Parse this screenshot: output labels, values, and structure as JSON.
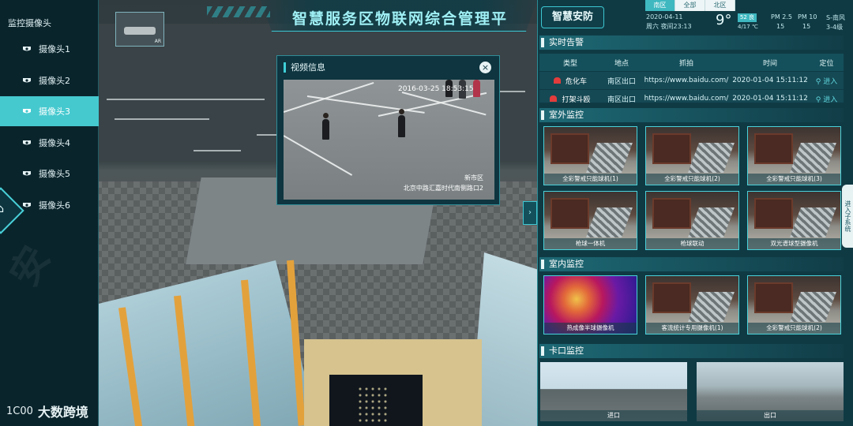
{
  "header": {
    "title": "智慧服务区物联网综合管理平"
  },
  "minimap": {
    "label": "AR"
  },
  "sidebar": {
    "heading": "监控摄像头",
    "items": [
      {
        "label": "摄像头1",
        "active": false
      },
      {
        "label": "摄像头2",
        "active": false
      },
      {
        "label": "摄像头3",
        "active": true
      },
      {
        "label": "摄像头4",
        "active": false
      },
      {
        "label": "摄像头5",
        "active": false
      },
      {
        "label": "摄像头6",
        "active": false
      }
    ],
    "home_icon": "home-icon"
  },
  "video": {
    "title": "视频信息",
    "close_label": "×",
    "timestamp": "2016-03-25  18:53:15",
    "location_line1": "新市区",
    "location_line2": "北京中路汇嘉时代南侧路口2"
  },
  "right": {
    "module_title": "智慧安防",
    "tabs": [
      {
        "label": "南区",
        "active": true
      },
      {
        "label": "全部",
        "active": false
      },
      {
        "label": "北区",
        "active": false
      }
    ],
    "weather": {
      "date": "2020-04-11",
      "week": "周六 夜间23:13",
      "temp": "9°",
      "badge": "52 良",
      "range": "4/17 ℃",
      "metrics": [
        {
          "label": "PM 2.5",
          "value": "15"
        },
        {
          "label": "PM 10",
          "value": "15"
        },
        {
          "label": "S-南风",
          "value": "3-4级"
        }
      ]
    },
    "alarm": {
      "title": "实时告警",
      "headers": [
        "类型",
        "地点",
        "抓拍",
        "时间",
        "定位"
      ],
      "rows": [
        {
          "type": "危化车",
          "place": "南区出口",
          "snapshot": "https://www.baidu.com/",
          "time": "2020-01-04 15:11:12",
          "action": "进入"
        },
        {
          "type": "打架斗殴",
          "place": "南区出口",
          "snapshot": "https://www.baidu.com/",
          "time": "2020-01-04 15:11:12",
          "action": "进入"
        }
      ]
    },
    "outdoor": {
      "title": "室外监控",
      "cams": [
        "全彩警戒只能球机(1)",
        "全彩警戒只能球机(2)",
        "全彩警戒只能球机(3)",
        "枪球一体机",
        "枪球联动",
        "双光谱球型摄像机"
      ]
    },
    "indoor": {
      "title": "室内监控",
      "cams": [
        "热成像半球摄像机",
        "客流统计专用摄像机(1)",
        "全彩警戒只能球机(2)"
      ]
    },
    "gate": {
      "title": "卡口监控",
      "cams": [
        "进口",
        "出口"
      ]
    },
    "subsystem": "进入子系统",
    "collapse": "›"
  },
  "watermark": {
    "logo": "1C00",
    "text": "大数跨境"
  },
  "colors": {
    "accent": "#45c9cf",
    "panel": "#0f3a44",
    "alarm_red": "#e23c3c"
  }
}
